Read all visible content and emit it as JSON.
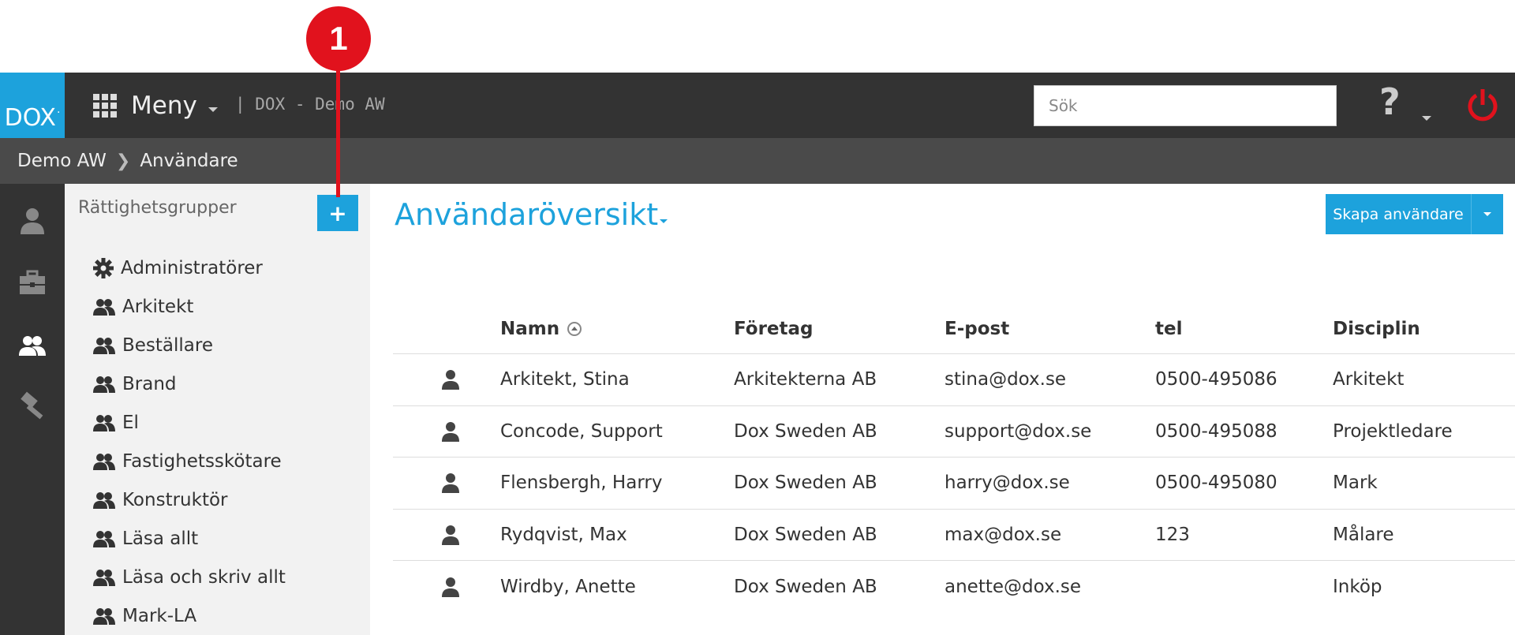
{
  "annotation": {
    "number": "1"
  },
  "header": {
    "logo": "DOX",
    "menu_label": "Meny",
    "app_title": "| DOX - Demo AW",
    "search_placeholder": "Sök",
    "help_label": "?"
  },
  "breadcrumb": [
    "Demo AW",
    "Användare"
  ],
  "sidebar_icons": [
    "user-icon",
    "briefcase-icon",
    "users-icon",
    "hammer-icon"
  ],
  "groups": {
    "title": "Rättighetsgrupper",
    "add_label": "+",
    "items": [
      {
        "label": "Administratörer",
        "icon": "gear-icon"
      },
      {
        "label": "Arkitekt",
        "icon": "users-icon"
      },
      {
        "label": "Beställare",
        "icon": "users-icon"
      },
      {
        "label": "Brand",
        "icon": "users-icon"
      },
      {
        "label": "El",
        "icon": "users-icon"
      },
      {
        "label": "Fastighetsskötare",
        "icon": "users-icon"
      },
      {
        "label": "Konstruktör",
        "icon": "users-icon"
      },
      {
        "label": "Läsa allt",
        "icon": "users-icon"
      },
      {
        "label": "Läsa och skriv allt",
        "icon": "users-icon"
      },
      {
        "label": "Mark-LA",
        "icon": "users-icon"
      }
    ]
  },
  "main": {
    "title": "Användaröversikt",
    "create_button": "Skapa användare"
  },
  "table": {
    "columns": [
      "Namn",
      "Företag",
      "E-post",
      "tel",
      "Disciplin"
    ],
    "rows": [
      [
        "Arkitekt, Stina",
        "Arkitekterna AB",
        "stina@dox.se",
        "0500-495086",
        "Arkitekt"
      ],
      [
        "Concode, Support",
        "Dox Sweden AB",
        "support@dox.se",
        "0500-495088",
        "Projektledare"
      ],
      [
        "Flensbergh, Harry",
        "Dox Sweden AB",
        "harry@dox.se",
        "0500-495080",
        "Mark"
      ],
      [
        "Rydqvist, Max",
        "Dox Sweden AB",
        "max@dox.se",
        "123",
        "Målare"
      ],
      [
        "Wirdby, Anette",
        "Dox Sweden AB",
        "anette@dox.se",
        "",
        "Inköp"
      ]
    ]
  },
  "colors": {
    "accent": "#1da2dc",
    "topbar": "#333333",
    "breadcrumb_bar": "#4a4a4a",
    "power": "#e1121d",
    "callout": "#e1121d"
  }
}
